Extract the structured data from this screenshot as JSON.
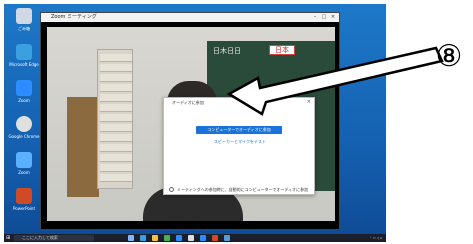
{
  "zoom_window": {
    "title": "Zoom ミーティング"
  },
  "dialog": {
    "title": "オーディオに参加",
    "join_button": "コンピューターでオーディオに参加",
    "test_link": "スピーカーとマイクをテスト",
    "auto_join_label": "ミーティングへの参加時に、自動的にコンピューターでオーディオに参加"
  },
  "video": {
    "blackboard_text": [
      "日木日日",
      "日本"
    ],
    "red_sign": "日本"
  },
  "desktop": {
    "icons": [
      "ごみ箱",
      "Microsoft Edge",
      "Zoom",
      "Google Chrome",
      "Zoom",
      "PowerPoint"
    ]
  },
  "taskbar": {
    "search_placeholder": "ここに入力して検索"
  },
  "annotation": {
    "step_number": "⑧",
    "arrow_target": "join-button"
  },
  "colors": {
    "desktop_blue": "#1560b0",
    "join_button": "#1a73d9",
    "blackboard": "#2a4a3a"
  }
}
